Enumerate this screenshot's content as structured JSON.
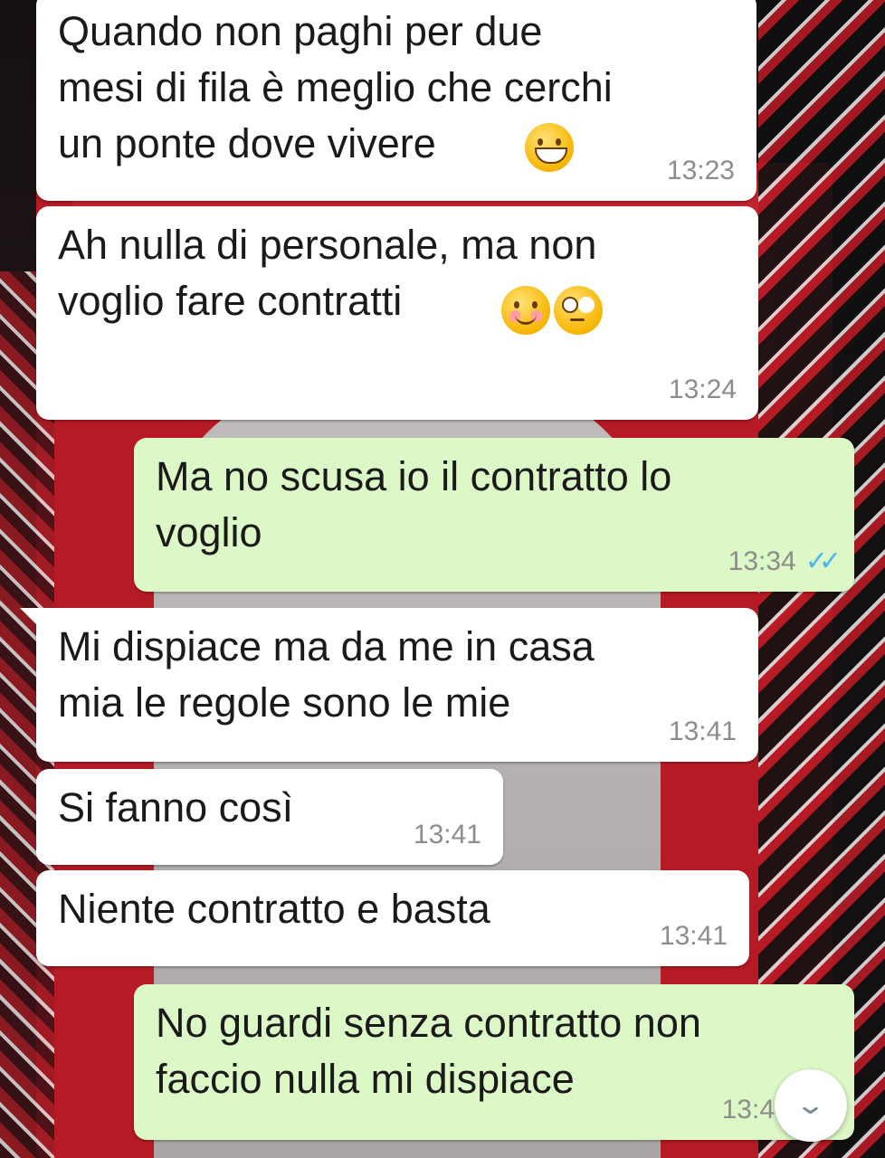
{
  "messages": [
    {
      "direction": "in",
      "text": "Quando non paghi per due\nmesi di fila è meglio che cerchi\nun ponte dove vivere",
      "emojis": [
        "grinning-face-emoji"
      ],
      "time": "13:23"
    },
    {
      "direction": "in",
      "text": "Ah nulla di personale, ma non\nvoglio fare contratti",
      "emojis": [
        "smiling-face-emoji",
        "eye-roll-emoji"
      ],
      "time": "13:24"
    },
    {
      "direction": "out",
      "text": "Ma no scusa io il contratto lo\nvoglio",
      "time": "13:34",
      "status": "read"
    },
    {
      "direction": "in",
      "text": "Mi dispiace ma da me in casa\nmia le regole sono le mie",
      "time": "13:41"
    },
    {
      "direction": "in",
      "text": "Si fanno così",
      "time": "13:41"
    },
    {
      "direction": "in",
      "text": "Niente contratto e basta",
      "time": "13:41"
    },
    {
      "direction": "out",
      "text": "No guardi senza contratto non\nfaccio nulla mi dispiace",
      "time": "13:4"
    }
  ],
  "read_ticks": "✓✓",
  "scroll_down_glyph": "⌄",
  "colors": {
    "incoming": "#ffffff",
    "outgoing": "#dcf8c6",
    "read_tick": "#4fb6ec",
    "timestamp": "#8c8c8c"
  }
}
